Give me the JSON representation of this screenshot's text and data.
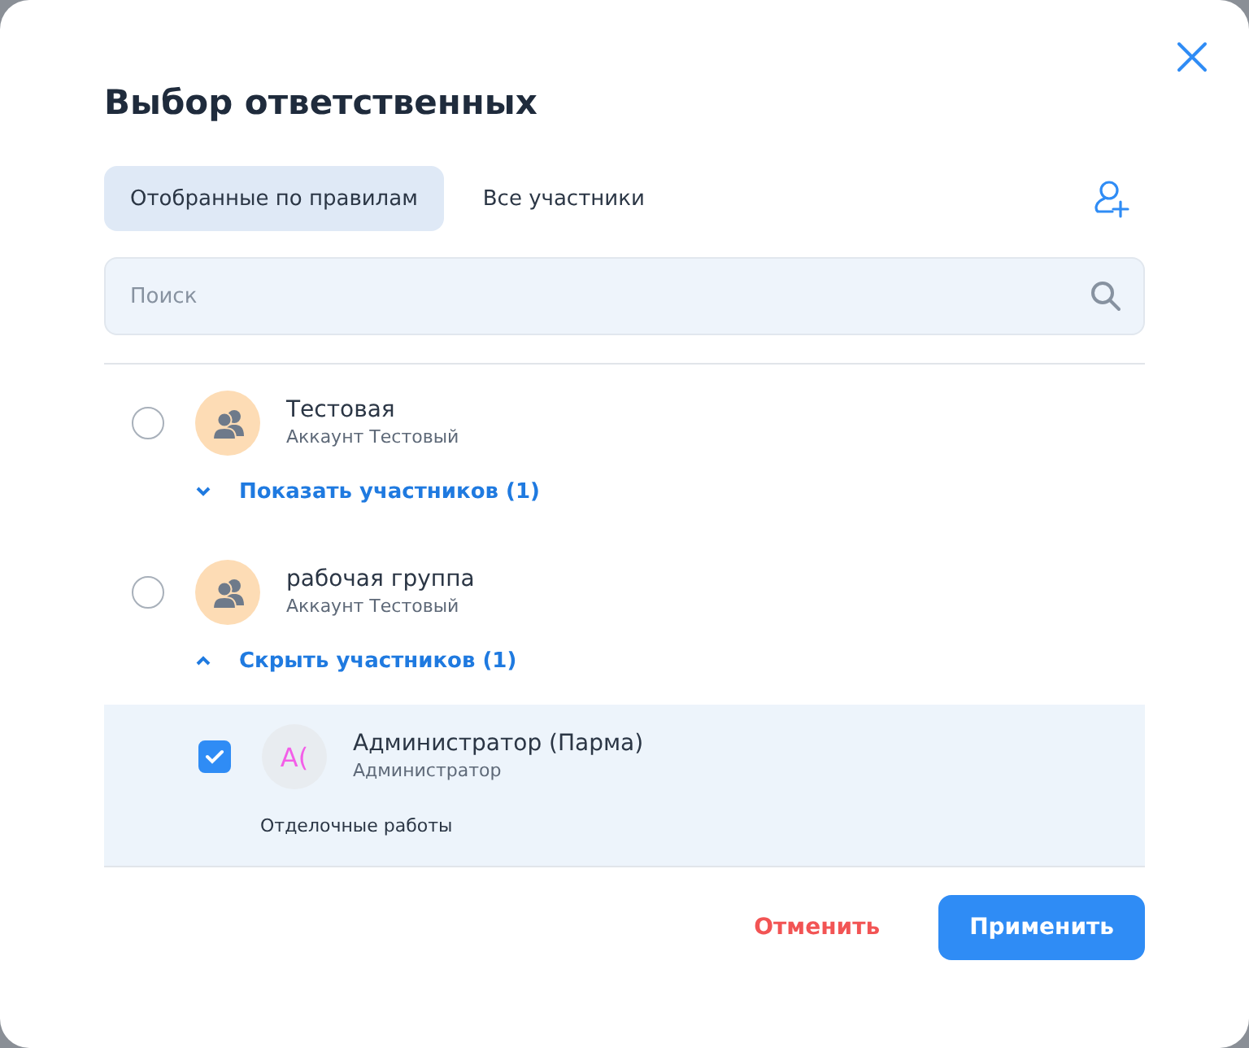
{
  "dialog": {
    "title": "Выбор ответственных"
  },
  "tabs": [
    {
      "label": "Отобранные по правилам",
      "selected": true
    },
    {
      "label": "Все участники",
      "selected": false
    }
  ],
  "search": {
    "placeholder": "Поиск"
  },
  "groups": [
    {
      "name": "Тестовая",
      "account": "Аккаунт Тестовый",
      "selected": false,
      "expanded": false,
      "toggle_label": "Показать участников (1)"
    },
    {
      "name": "рабочая группа",
      "account": "Аккаунт Тестовый",
      "selected": false,
      "expanded": true,
      "toggle_label": "Скрыть участников (1)",
      "members": [
        {
          "initials": "А(",
          "name": "Администратор (Парма)",
          "role": "Администратор",
          "note": "Отделочные работы",
          "checked": true
        }
      ]
    }
  ],
  "buttons": {
    "cancel": "Отменить",
    "apply": "Применить"
  }
}
